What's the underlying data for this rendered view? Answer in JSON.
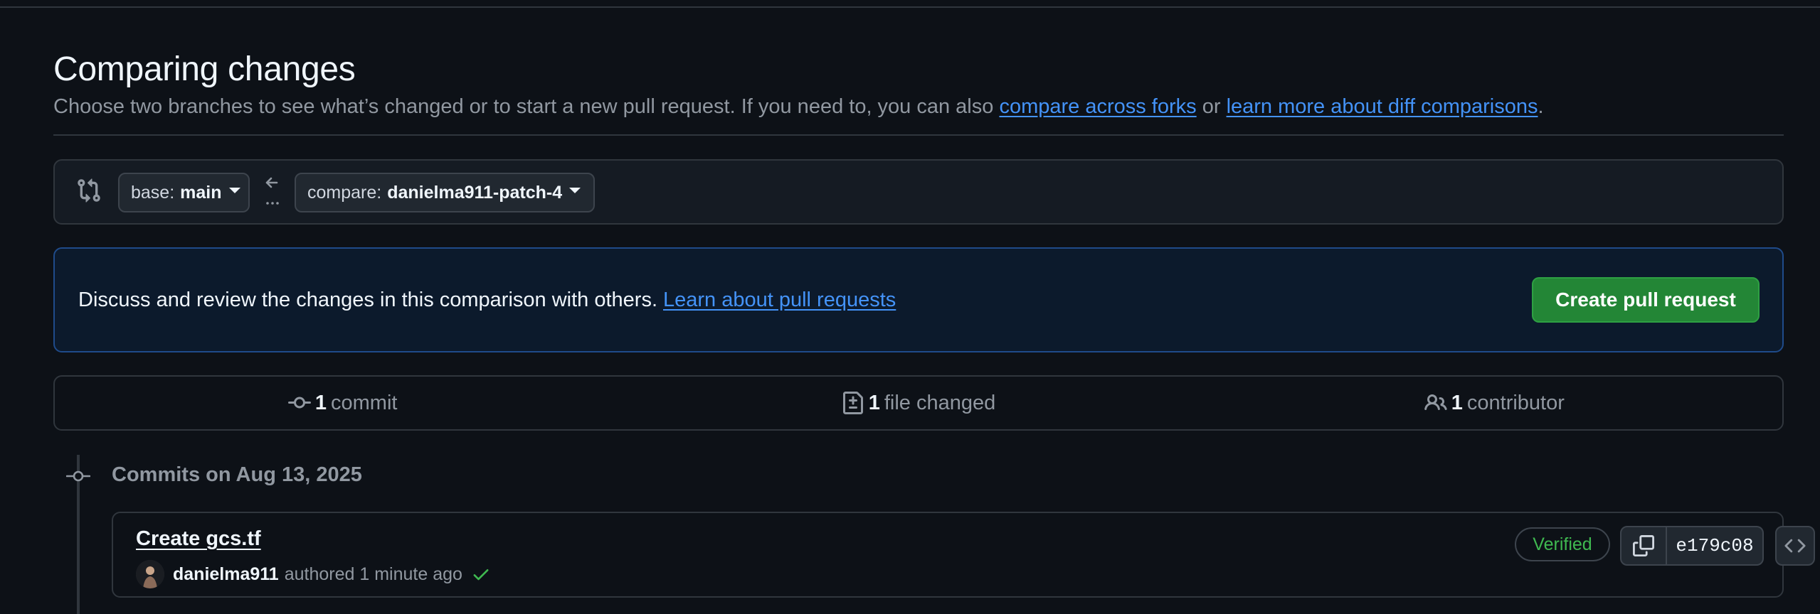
{
  "header": {
    "title": "Comparing changes",
    "subtitle_prefix": "Choose two branches to see what’s changed or to start a new pull request. If you need to, you can also ",
    "compare_forks_link": "compare across forks",
    "subtitle_or": " or ",
    "learn_diff_link": "learn more about diff comparisons",
    "subtitle_suffix": "."
  },
  "range": {
    "base_label": "base:",
    "base_value": "main",
    "compare_label": "compare:",
    "compare_value": "danielma911-patch-4"
  },
  "banner": {
    "text": "Discuss and review the changes in this comparison with others.",
    "link": "Learn about pull requests",
    "button": "Create pull request"
  },
  "stats": {
    "commits_count": "1",
    "commits_label": "commit",
    "files_count": "1",
    "files_label": "file changed",
    "contributors_count": "1",
    "contributors_label": "contributor"
  },
  "timeline": {
    "date_heading": "Commits on Aug 13, 2025"
  },
  "commit": {
    "title": "Create gcs.tf",
    "author": "danielma911",
    "meta": "authored 1 minute ago",
    "verified": "Verified",
    "sha": "e179c08"
  },
  "colors": {
    "background": "#0d1117",
    "link": "#4493f8",
    "success": "#3fb950",
    "primary_button": "#238636"
  },
  "icons": [
    "git-compare-icon",
    "arrow-left-icon",
    "caret-down-icon",
    "git-commit-icon",
    "file-diff-icon",
    "people-icon",
    "check-icon",
    "copy-icon",
    "code-icon"
  ]
}
